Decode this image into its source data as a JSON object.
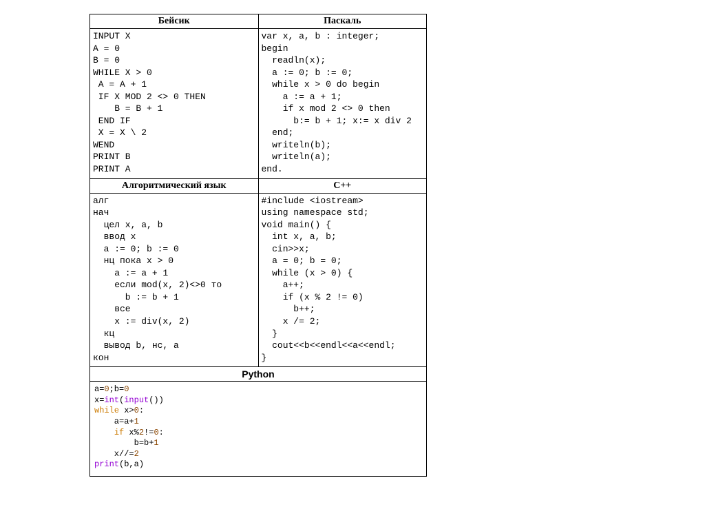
{
  "headers": {
    "basic": "Бейсик",
    "pascal": "Паскаль",
    "algo": "Алгоритмический язык",
    "cpp": "С++",
    "python": "Python"
  },
  "code": {
    "basic": "INPUT X\nA = 0\nB = 0\nWHILE X > 0\n A = A + 1\n IF X MOD 2 <> 0 THEN\n    B = B + 1\n END IF\n X = X \\ 2\nWEND\nPRINT B\nPRINT A",
    "pascal": "var x, a, b : integer;\nbegin\n  readln(x);\n  a := 0; b := 0;\n  while x > 0 do begin\n    a := a + 1;\n    if x mod 2 <> 0 then\n      b:= b + 1; x:= x div 2\n  end;\n  writeln(b);\n  writeln(a);\nend.",
    "algo": "алг\nнач\n  цел x, a, b\n  ввод x\n  a := 0; b := 0\n  нц пока x > 0\n    a := a + 1\n    если mod(x, 2)<>0 то\n      b := b + 1\n    все\n    x := div(x, 2)\n  кц\n  вывод b, нс, a\nкон",
    "cpp": "#include <iostream>\nusing namespace std;\nvoid main() {\n  int x, a, b;\n  cin>>x;\n  a = 0; b = 0;\n  while (x > 0) {\n    a++;\n    if (x % 2 != 0)\n      b++;\n    x /= 2;\n  }\n  cout<<b<<endl<<a<<endl;\n}"
  },
  "python_tokens": [
    {
      "t": "a",
      "c": "black"
    },
    {
      "t": "=",
      "c": "black"
    },
    {
      "t": "0",
      "c": "brown"
    },
    {
      "t": ";b",
      "c": "black"
    },
    {
      "t": "=",
      "c": "black"
    },
    {
      "t": "0",
      "c": "brown"
    },
    {
      "t": "\n",
      "c": "black"
    },
    {
      "t": "x",
      "c": "black"
    },
    {
      "t": "=",
      "c": "black"
    },
    {
      "t": "int",
      "c": "purple"
    },
    {
      "t": "(",
      "c": "black"
    },
    {
      "t": "input",
      "c": "purple"
    },
    {
      "t": "())",
      "c": "black"
    },
    {
      "t": "\n",
      "c": "black"
    },
    {
      "t": "while",
      "c": "orange"
    },
    {
      "t": " x",
      "c": "black"
    },
    {
      "t": ">",
      "c": "black"
    },
    {
      "t": "0",
      "c": "brown"
    },
    {
      "t": ":",
      "c": "black"
    },
    {
      "t": "\n",
      "c": "black"
    },
    {
      "t": "    a",
      "c": "black"
    },
    {
      "t": "=",
      "c": "black"
    },
    {
      "t": "a",
      "c": "black"
    },
    {
      "t": "+",
      "c": "black"
    },
    {
      "t": "1",
      "c": "brown"
    },
    {
      "t": "\n",
      "c": "black"
    },
    {
      "t": "    ",
      "c": "black"
    },
    {
      "t": "if",
      "c": "orange"
    },
    {
      "t": " x",
      "c": "black"
    },
    {
      "t": "%",
      "c": "black"
    },
    {
      "t": "2",
      "c": "brown"
    },
    {
      "t": "!=",
      "c": "black"
    },
    {
      "t": "0",
      "c": "brown"
    },
    {
      "t": ":",
      "c": "black"
    },
    {
      "t": "\n",
      "c": "black"
    },
    {
      "t": "        b",
      "c": "black"
    },
    {
      "t": "=",
      "c": "black"
    },
    {
      "t": "b",
      "c": "black"
    },
    {
      "t": "+",
      "c": "black"
    },
    {
      "t": "1",
      "c": "brown"
    },
    {
      "t": "\n",
      "c": "black"
    },
    {
      "t": "    x",
      "c": "black"
    },
    {
      "t": "//",
      "c": "black"
    },
    {
      "t": "=",
      "c": "black"
    },
    {
      "t": "2",
      "c": "brown"
    },
    {
      "t": "\n",
      "c": "black"
    },
    {
      "t": "print",
      "c": "purple"
    },
    {
      "t": "(b,a)",
      "c": "black"
    }
  ]
}
